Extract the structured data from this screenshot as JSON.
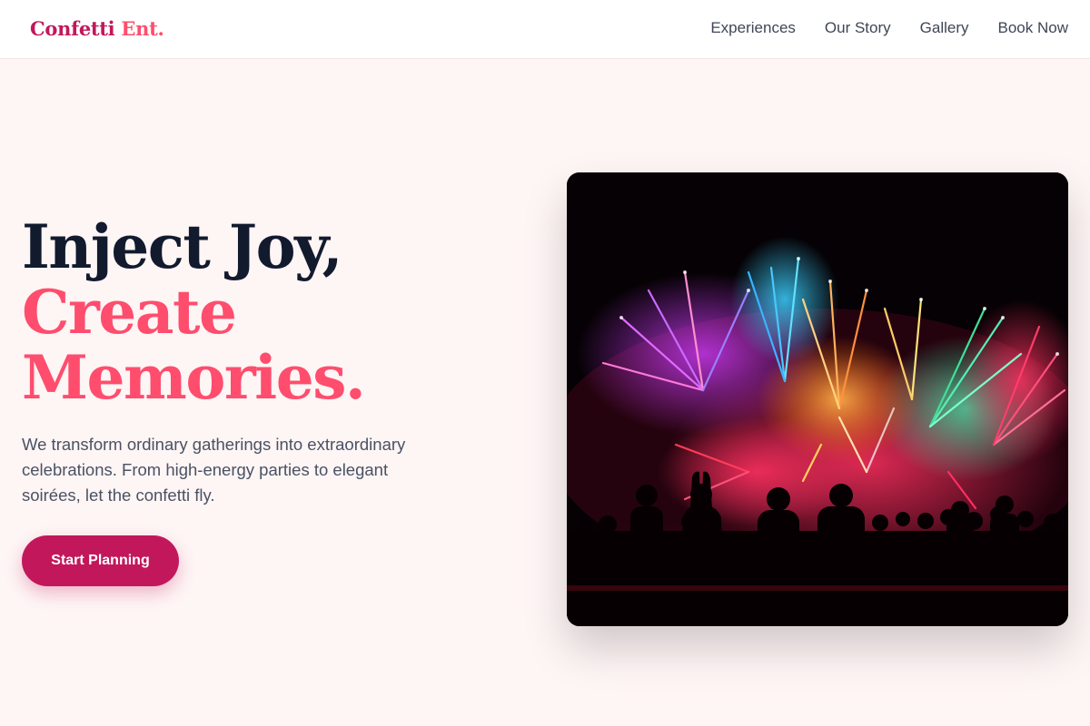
{
  "header": {
    "logo": {
      "word1": "Confetti",
      "word2": "Ent."
    },
    "nav": [
      {
        "label": "Experiences"
      },
      {
        "label": "Our Story"
      },
      {
        "label": "Gallery"
      },
      {
        "label": "Book Now"
      }
    ]
  },
  "hero": {
    "headline": {
      "line1": "Inject Joy,",
      "line2": "Create",
      "line3": "Memories."
    },
    "lead": "We transform ordinary gatherings into extraordinary celebrations. From high-energy parties to elegant soirées, let the confetti fly.",
    "cta_label": "Start Planning",
    "image": {
      "subject": "fireworks-crowd-silhouette"
    }
  },
  "colors": {
    "brand": "#c2185b",
    "accent": "#ff4d6d",
    "heading": "#121a2e",
    "background": "#fef5f5"
  }
}
